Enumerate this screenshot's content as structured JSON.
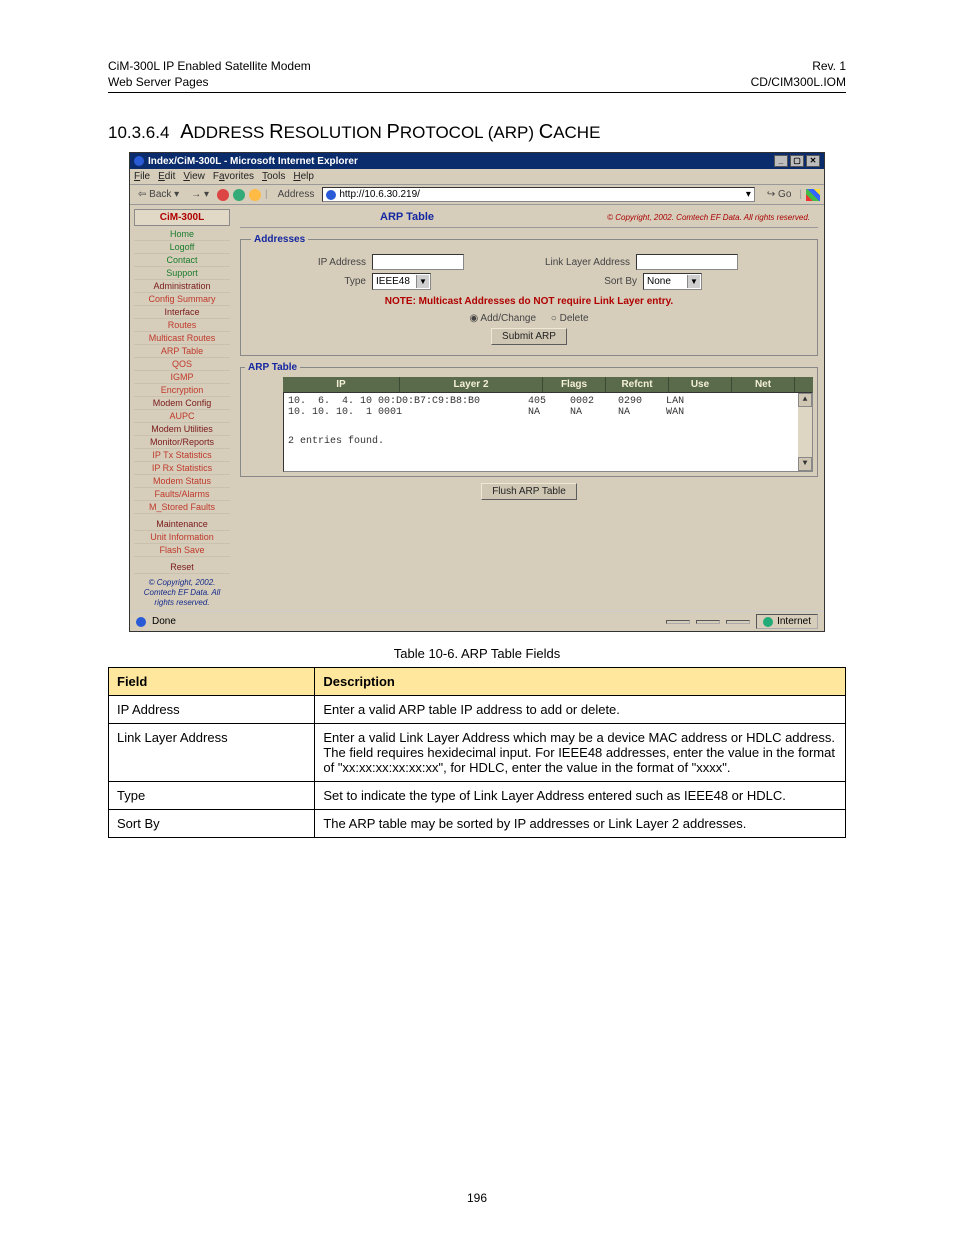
{
  "doc": {
    "header_left": "CiM-300L IP Enabled Satellite Modem\nWeb Server Pages",
    "header_right": "Rev. 1\nCD/CIM300L.IOM",
    "section_number": "10.3.6.4",
    "section_title_word1": "A",
    "section_title_rest": "DDRESS ",
    "section_title_w2a": "R",
    "section_title_w2b": "ESOLUTION ",
    "section_title_w3a": "P",
    "section_title_w3b": "ROTOCOL ",
    "section_title_paren": "(ARP) ",
    "section_title_w4a": "C",
    "section_title_w4b": "ACHE",
    "table_caption": "Table 10-6.  ARP Table Fields",
    "page_number": "196"
  },
  "browser": {
    "window_title": "Index/CiM-300L - Microsoft Internet Explorer",
    "menus": [
      "File",
      "Edit",
      "View",
      "Favorites",
      "Tools",
      "Help"
    ],
    "back_label": "Back",
    "address_label": "Address",
    "url": "http://10.6.30.219/",
    "go_label": "Go",
    "status_done": "Done",
    "status_zone": "Internet"
  },
  "sidebar": {
    "product": "CiM-300L",
    "groups": [
      {
        "items": [
          "Home",
          "Logoff",
          "Contact",
          "Support"
        ],
        "color": "green"
      },
      {
        "title": "Administration",
        "items": [
          "Config Summary"
        ]
      },
      {
        "title": "Interface",
        "items": [
          "Routes",
          "Multicast Routes",
          "ARP Table",
          "QOS",
          "IGMP",
          "Encryption"
        ]
      },
      {
        "title": "Modem Config",
        "items": [
          "AUPC"
        ]
      },
      {
        "title": "Modem Utilities",
        "items": []
      },
      {
        "title": "Monitor/Reports",
        "items": [
          "IP Tx Statistics",
          "IP Rx Statistics",
          "Modem Status",
          "Faults/Alarms",
          "M_Stored Faults"
        ]
      },
      {
        "title": "Maintenance",
        "items": [
          "Unit Information",
          "Flash Save"
        ]
      },
      {
        "title": "Reset",
        "items": []
      }
    ],
    "copyright": "© Copyright, 2002. Comtech EF Data. All rights reserved."
  },
  "arp_panel": {
    "title": "ARP Table",
    "top_copyright": "© Copyright, 2002. Comtech EF Data. All rights reserved.",
    "addresses_legend": "Addresses",
    "ip_address_label": "IP Address",
    "link_layer_label": "Link Layer Address",
    "type_label": "Type",
    "type_value": "IEEE48",
    "sortby_label": "Sort By",
    "sortby_value": "None",
    "note": "NOTE: Multicast Addresses do NOT require Link Layer entry.",
    "add_change_label": "Add/Change",
    "delete_label": "Delete",
    "submit_btn": "Submit ARP",
    "arp_table_legend": "ARP Table",
    "columns": [
      "IP",
      "Layer 2",
      "Flags",
      "Refcnt",
      "Use",
      "Net"
    ],
    "rows_text": "10.  6.  4. 10 00:D0:B7:C9:B8:B0        405    0002    0290    LAN\n10. 10. 10.  1 0001                     NA     NA      NA      WAN",
    "entries_found": "2 entries found.",
    "flush_btn": "Flush ARP Table"
  },
  "fields_table": {
    "head_field": "Field",
    "head_desc": "Description",
    "rows": [
      {
        "f": "IP Address",
        "d": "Enter a valid ARP table IP address to add or delete."
      },
      {
        "f": "Link Layer Address",
        "d": "Enter a valid Link Layer Address which may be a device MAC address or HDLC address.  The field requires hexidecimal input.  For IEEE48 addresses, enter the value in the format of \"xx:xx:xx:xx:xx:xx\", for HDLC, enter the value in the format of \"xxxx\"."
      },
      {
        "f": "Type",
        "d": "Set to indicate the type of Link Layer Address entered such as IEEE48 or HDLC."
      },
      {
        "f": "Sort By",
        "d": "The ARP table may be sorted by IP addresses or Link Layer 2 addresses."
      }
    ]
  }
}
